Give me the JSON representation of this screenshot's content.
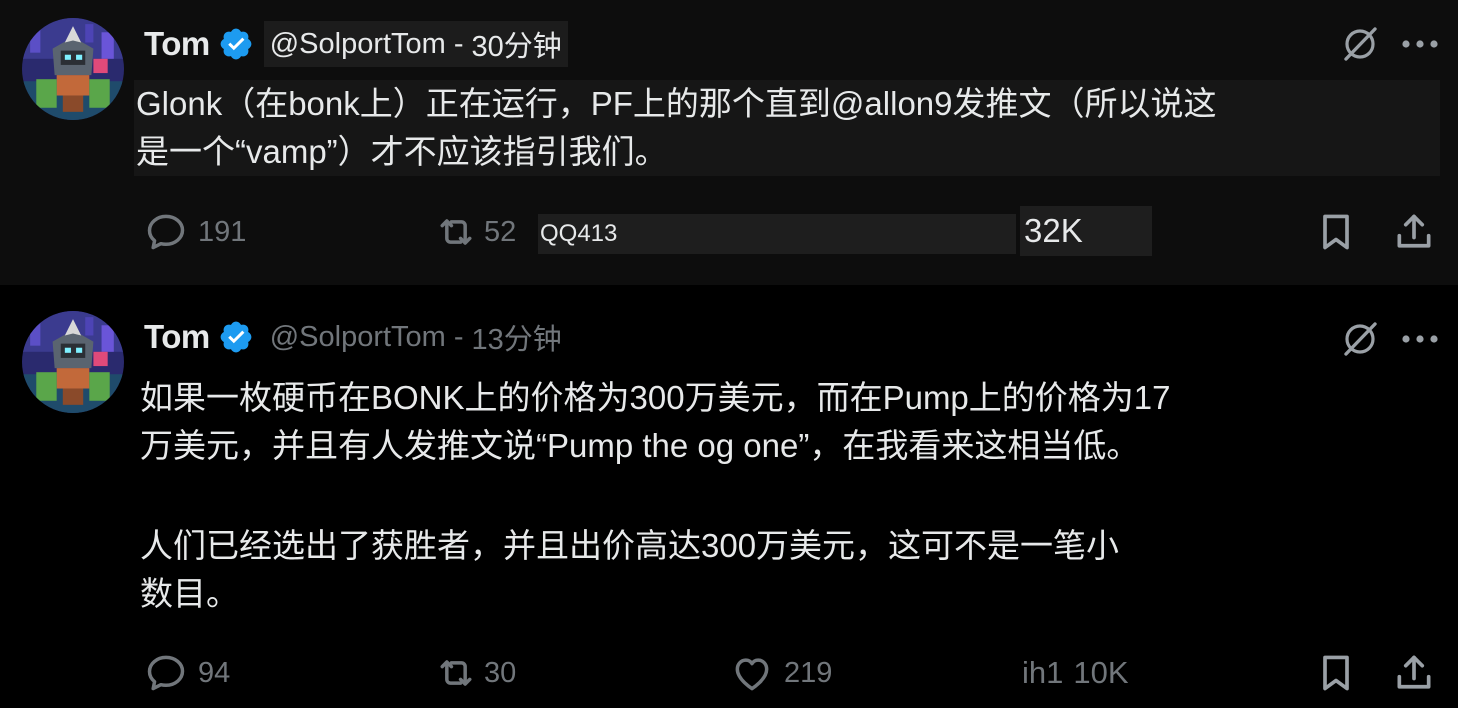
{
  "tweets": [
    {
      "author_name": "Tom",
      "handle": "@SolportTom",
      "separator": "-",
      "time": "30分钟",
      "text_lines": [
        "Glonk（在bonk上）正在运行，PF上的那个直到@allon9发推文（所以说这",
        "是一个“vamp”）才不应该指引我们。"
      ],
      "replies": "191",
      "reposts": "52",
      "overlay_label": "QQ413",
      "views": "32K"
    },
    {
      "author_name": "Tom",
      "handle": "@SolportTom",
      "separator": "-",
      "time": "13分钟",
      "paragraphs": [
        [
          "如果一枚硬币在BONK上的价格为300万美元，而在Pump上的价格为17",
          "万美元，并且有人发推文说“Pump the og one”，在我看来这相当低。"
        ],
        [
          "人们已经选出了获胜者，并且出价高达300万美元，这可不是一笔小",
          "数目。"
        ]
      ],
      "replies": "94",
      "reposts": "30",
      "likes": "219",
      "views_prefix": "ih1",
      "views": "10K"
    }
  ],
  "icons": {
    "verified": "verified-badge-icon",
    "grok": "grok-slash-icon",
    "more": "more-dots-icon",
    "reply": "reply-bubble-icon",
    "repost": "repost-arrows-icon",
    "like": "heart-icon",
    "bookmark": "bookmark-icon",
    "share": "share-upload-icon"
  },
  "colors": {
    "background": "#000000",
    "text": "#e7e9ea",
    "muted": "#71767b",
    "verified_blue": "#1d9bf0",
    "thread_line": "#3a3f44"
  }
}
